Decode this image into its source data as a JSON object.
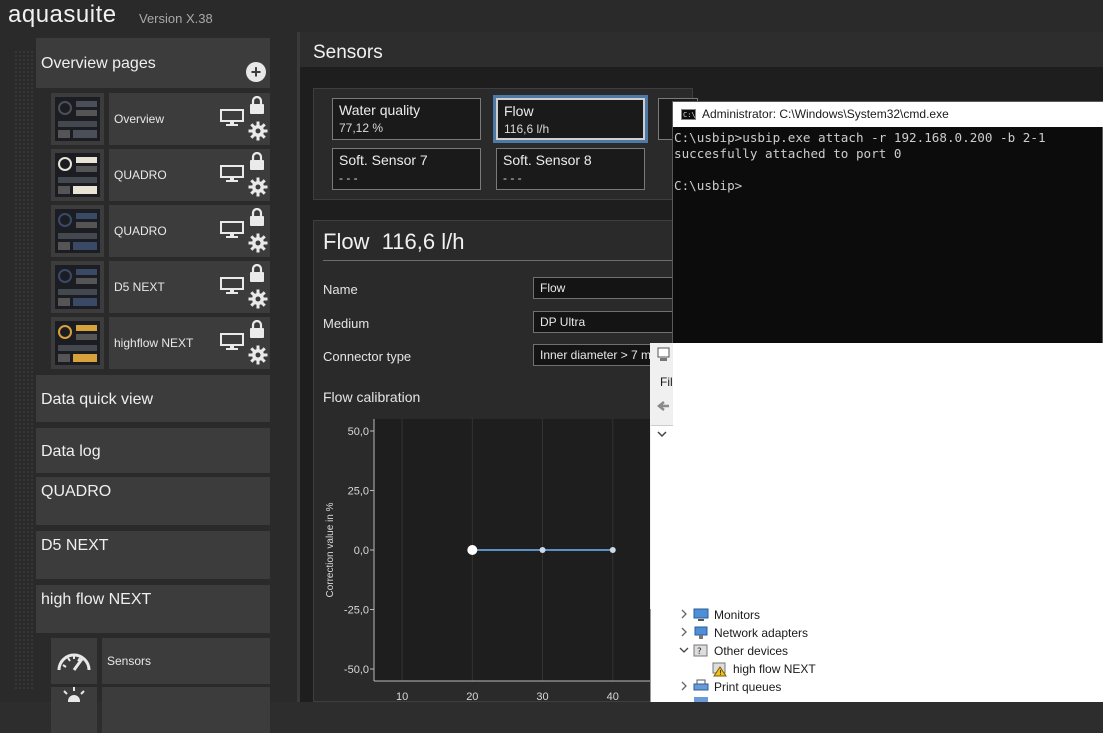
{
  "app": {
    "title": "aquasuite",
    "version": "Version X.38"
  },
  "sidebar": {
    "overview_pages": "Overview pages",
    "overview_items": [
      {
        "name": "Overview"
      },
      {
        "name": "QUADRO"
      },
      {
        "name": "QUADRO"
      },
      {
        "name": "D5 NEXT"
      },
      {
        "name": "highflow NEXT"
      }
    ],
    "sections": [
      "Data quick view",
      "Data log",
      "QUADRO",
      "D5 NEXT",
      "high flow NEXT"
    ],
    "sub_items": [
      {
        "name": "Sensors"
      },
      {
        "name": ""
      }
    ]
  },
  "main": {
    "title": "Sensors",
    "tiles": [
      {
        "label": "Water quality",
        "value": "77,12 %"
      },
      {
        "label": "Flow",
        "value": "116,6 l/h"
      },
      {
        "label": "Soft. Sensor 7",
        "value": "- - -"
      },
      {
        "label": "Soft. Sensor 8",
        "value": "- - -"
      }
    ],
    "detail": {
      "name": "Flow",
      "value": "116,6 l/h",
      "fields": [
        {
          "label": "Name",
          "value": "Flow"
        },
        {
          "label": "Medium",
          "value": "DP Ultra"
        },
        {
          "label": "Connector type",
          "value": "Inner diameter > 7 m"
        }
      ],
      "calibration_label": "Flow calibration"
    }
  },
  "chart_data": {
    "type": "line",
    "title": "Flow calibration",
    "xlabel": "",
    "ylabel": "Correction value in %",
    "x_ticks": [
      "10",
      "20",
      "30",
      "40"
    ],
    "y_ticks": [
      "50,0",
      "25,0",
      "0,0",
      "-25,0",
      "-50,0"
    ],
    "ylim": [
      -50,
      50
    ],
    "series": [
      {
        "x": [
          20,
          30,
          40
        ],
        "y": [
          0,
          0,
          0
        ]
      }
    ],
    "grid": true,
    "colors": {
      "line": "#5b8fc7"
    }
  },
  "cmd": {
    "title": "Administrator: C:\\Windows\\System32\\cmd.exe",
    "lines": [
      "C:\\usbip>usbip.exe attach -r 192.168.0.200 -b 2-1",
      "succesfully attached to port 0",
      "",
      "C:\\usbip>"
    ]
  },
  "device_manager": {
    "menu_fragment": "Fil",
    "tree": [
      {
        "label": "Monitors"
      },
      {
        "label": "Network adapters"
      },
      {
        "label": "Other devices"
      },
      {
        "label": "high flow NEXT"
      },
      {
        "label": "Print queues"
      }
    ]
  }
}
